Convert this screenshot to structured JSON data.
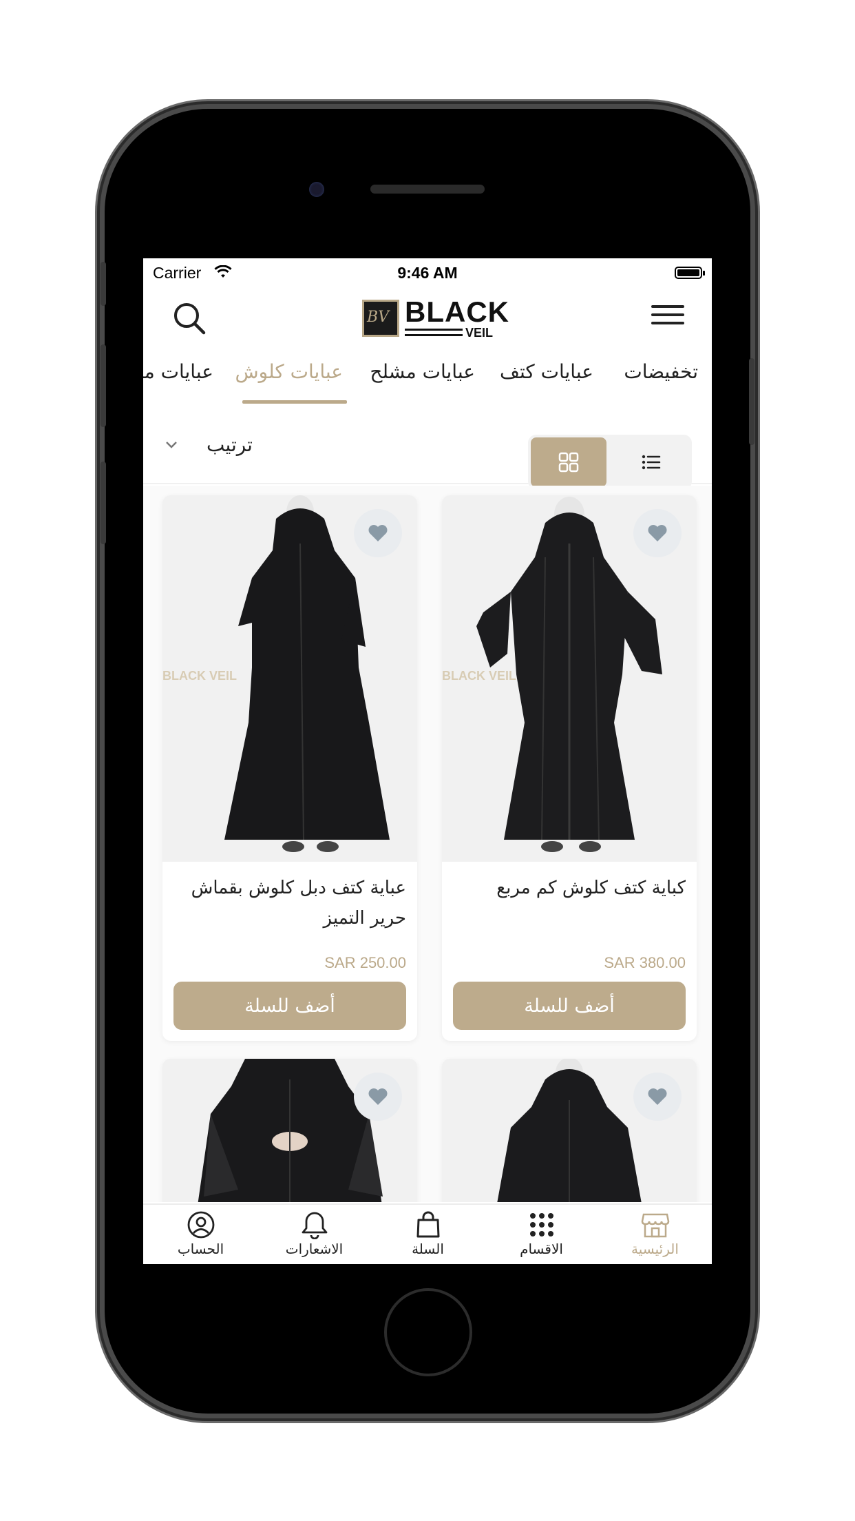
{
  "status_bar": {
    "carrier": "Carrier",
    "time": "9:46 AM"
  },
  "header": {
    "brand_name": "BLACK",
    "brand_sub": "VEIL"
  },
  "categories": [
    {
      "label": "تخفيضات",
      "active": false
    },
    {
      "label": "عبايات كتف",
      "active": false
    },
    {
      "label": "عبايات مشلح",
      "active": false
    },
    {
      "label": "عبايات كلوش",
      "active": true
    },
    {
      "label": "عبايات ملـ",
      "active": false
    }
  ],
  "toolbar": {
    "sort_label": "ترتيب",
    "view_mode": "grid"
  },
  "products": [
    {
      "title": "كباية كتف كلوش كم مربع",
      "price": "SAR 380.00",
      "add_label": "أضف للسلة"
    },
    {
      "title": "عباية كتف دبل كلوش بقماش حرير التميز",
      "price": "SAR 250.00",
      "add_label": "أضف للسلة"
    },
    {
      "title": "",
      "price": "",
      "add_label": ""
    },
    {
      "title": "",
      "price": "",
      "add_label": ""
    }
  ],
  "watermark_text": "BLACK VEIL",
  "tabbar": [
    {
      "label": "الرئيسية",
      "icon": "store-icon",
      "active": true
    },
    {
      "label": "الاقسام",
      "icon": "grid-dots-icon",
      "active": false
    },
    {
      "label": "السلة",
      "icon": "bag-icon",
      "active": false
    },
    {
      "label": "الاشعارات",
      "icon": "bell-icon",
      "active": false
    },
    {
      "label": "الحساب",
      "icon": "user-circle-icon",
      "active": false
    }
  ],
  "colors": {
    "accent": "#bba98a",
    "button": "#bdab8c",
    "text": "#222222",
    "favorite_bg": "#e9ecef",
    "heart": "#8a9aa6"
  }
}
